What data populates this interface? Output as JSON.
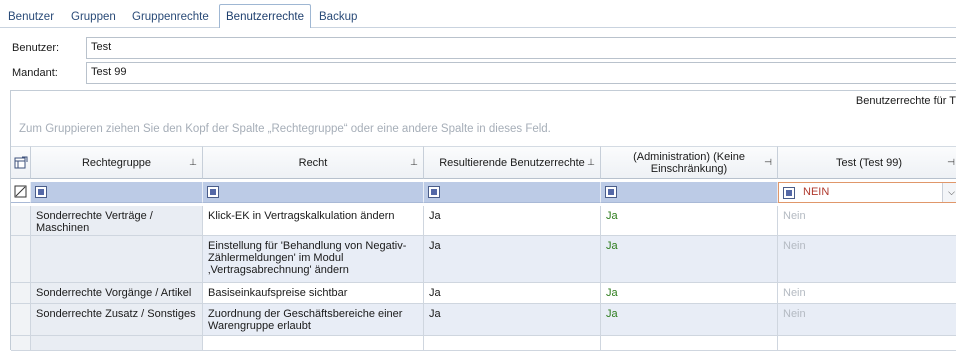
{
  "tabs": [
    {
      "label": "Benutzer",
      "active": false
    },
    {
      "label": "Gruppen",
      "active": false
    },
    {
      "label": "Gruppenrechte",
      "active": false
    },
    {
      "label": "Benutzerrechte",
      "active": true
    },
    {
      "label": "Backup",
      "active": false
    }
  ],
  "form": {
    "user_label": "Benutzer:",
    "user_value": "Test",
    "client_label": "Mandant:",
    "client_value": "Test 99"
  },
  "grid": {
    "caption": "Benutzerrechte für T",
    "group_hint": "Zum Gruppieren ziehen Sie den Kopf der Spalte „Rechtegruppe“ oder eine andere Spalte in dieses Feld.",
    "columns": [
      "Rechtegruppe",
      "Recht",
      "Resultierende Benutzerrechte",
      "(Administration) (Keine Einschränkung)",
      "Test (Test 99)"
    ],
    "filter_value": "NEIN",
    "rows": [
      {
        "group": "Sonderrechte Verträge / Maschinen",
        "right": "Klick-EK in Vertragskalkulation ändern",
        "result": "Ja",
        "admin": "Ja",
        "user": "Nein"
      },
      {
        "group": "",
        "right": "Einstellung für 'Behandlung von Negativ-Zählermeldungen' im Modul ‚Vertragsabrechnung' ändern",
        "result": "Ja",
        "admin": "Ja",
        "user": "Nein"
      },
      {
        "group": "Sonderrechte Vorgänge / Artikel",
        "right": "Basiseinkaufspreise  sichtbar",
        "result": "Ja",
        "admin": "Ja",
        "user": "Nein"
      },
      {
        "group": "Sonderrechte Zusatz / Sonstiges",
        "right": "Zuordnung der Geschäftsbereiche einer Warengruppe erlaubt",
        "result": "Ja",
        "admin": "Ja",
        "user": "Nein"
      }
    ]
  },
  "colors": {
    "accent": "#2a4b78",
    "filter_row": "#bccbe6",
    "yes_green": "#2e7d1e",
    "no_gray": "#b4bac2",
    "filter_text": "#b03a2e"
  }
}
